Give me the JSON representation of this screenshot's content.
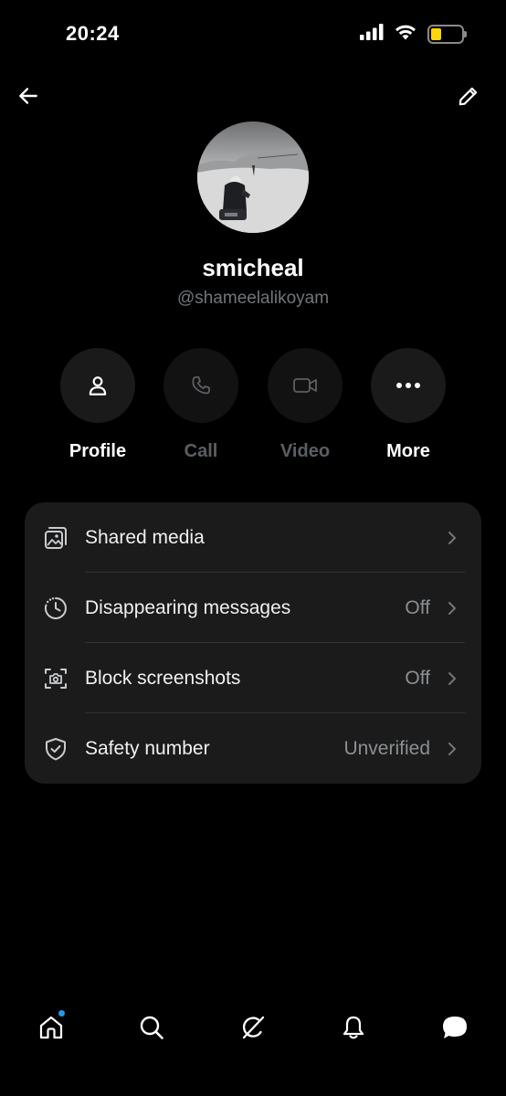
{
  "status_bar": {
    "time": "20:24",
    "icons": [
      "cellular-signal-icon",
      "wifi-icon",
      "battery-icon"
    ],
    "battery_level": 0.35,
    "battery_color": "#ffd60a"
  },
  "header": {
    "back_icon": "arrow-left-icon",
    "edit_icon": "pencil-icon"
  },
  "profile": {
    "display_name": "smicheal",
    "handle": "@shameelalikoyam",
    "avatar_icon": "avatar-photo"
  },
  "actions": [
    {
      "label": "Profile",
      "icon": "person-icon",
      "enabled": true
    },
    {
      "label": "Call",
      "icon": "phone-icon",
      "enabled": false
    },
    {
      "label": "Video",
      "icon": "video-camera-icon",
      "enabled": false
    },
    {
      "label": "More",
      "icon": "ellipsis-icon",
      "enabled": true
    }
  ],
  "settings": [
    {
      "label": "Shared media",
      "value": "",
      "icon": "media-gallery-icon"
    },
    {
      "label": "Disappearing messages",
      "value": "Off",
      "icon": "timer-icon"
    },
    {
      "label": "Block screenshots",
      "value": "Off",
      "icon": "screenshot-camera-icon"
    },
    {
      "label": "Safety number",
      "value": "Unverified",
      "icon": "shield-check-icon"
    }
  ],
  "bottom_nav": [
    {
      "name": "home",
      "icon": "home-icon",
      "has_badge": true
    },
    {
      "name": "search",
      "icon": "search-icon",
      "has_badge": false
    },
    {
      "name": "grok",
      "icon": "grok-icon",
      "has_badge": false
    },
    {
      "name": "notifications",
      "icon": "bell-icon",
      "has_badge": false
    },
    {
      "name": "messages",
      "icon": "chat-bubble-icon",
      "has_badge": false
    }
  ],
  "colors": {
    "background": "#000000",
    "card": "#1b1b1b",
    "accent": "#1d9bf0",
    "secondary_text": "#71767b"
  }
}
